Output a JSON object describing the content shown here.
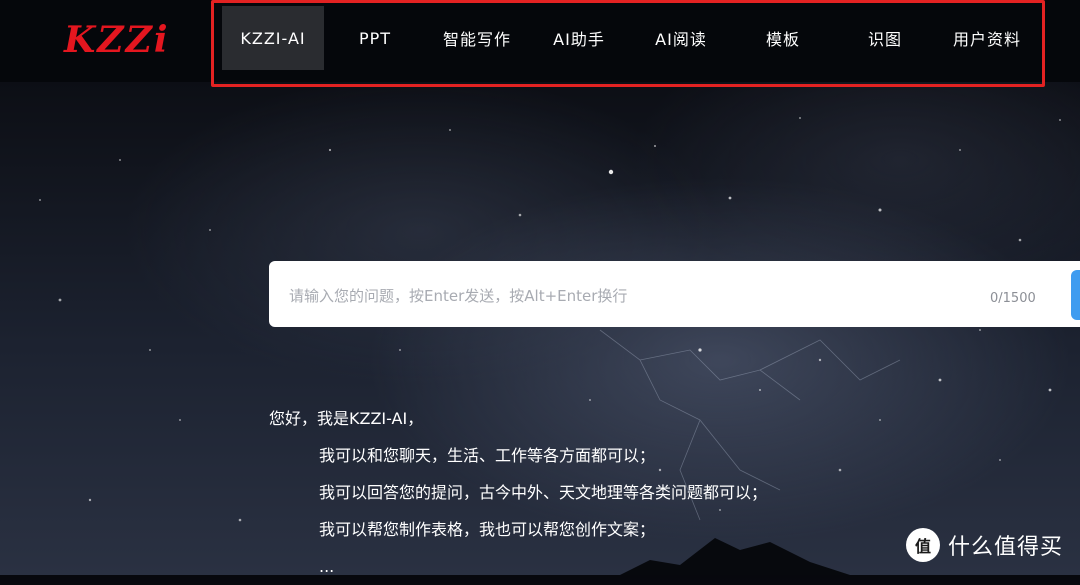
{
  "header": {
    "logo": "KZZi",
    "nav": [
      {
        "label": "KZZI-AI",
        "active": true
      },
      {
        "label": "PPT",
        "active": false
      },
      {
        "label": "智能写作",
        "active": false
      },
      {
        "label": "AI助手",
        "active": false
      },
      {
        "label": "AI阅读",
        "active": false
      },
      {
        "label": "模板",
        "active": false
      },
      {
        "label": "识图",
        "active": false
      },
      {
        "label": "用户资料",
        "active": false
      }
    ],
    "highlight_color": "#e32222"
  },
  "search": {
    "placeholder": "请输入您的问题，按Enter发送，按Alt+Enter换行",
    "value": "",
    "counter": "0/1500",
    "send_button_color": "#3f9cf0"
  },
  "intro": {
    "greeting": "您好，我是KZZI-AI，",
    "lines": [
      "我可以和您聊天，生活、工作等各方面都可以；",
      "我可以回答您的提问，古今中外、天文地理等各类问题都可以；",
      "我可以帮您制作表格，我也可以帮您创作文案；",
      "..."
    ]
  },
  "watermark": {
    "badge": "值",
    "text": "什么值得买"
  },
  "colors": {
    "logo": "#e4161f",
    "nav_active_bg": "#2a2c30",
    "topbar_bg": "#05070b"
  }
}
